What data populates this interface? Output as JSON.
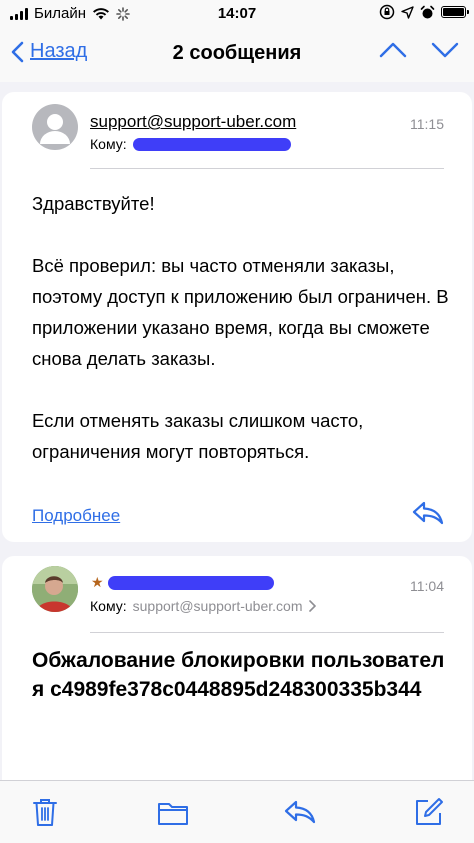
{
  "status_bar": {
    "carrier": "Билайн",
    "time": "14:07"
  },
  "nav": {
    "back_label": "Назад",
    "title": "2 сообщения"
  },
  "message1": {
    "sender": "support@support-uber.com",
    "time": "11:15",
    "to_label": "Кому:",
    "body": [
      "Здравствуйте!",
      "Всё проверил: вы часто отменяли заказы, поэтому доступ к приложению был ограничен. В приложении указано время, когда вы сможете снова делать заказы.",
      "Если отменять заказы слишком часто, ограничения могут повторяться."
    ],
    "more_label": "Подробнее"
  },
  "message2": {
    "time": "11:04",
    "to_label": "Кому:",
    "to_address": "support@support-uber.com",
    "subject": "Обжалование блокировки пользователя c4989fe378c0448895d248300335b344"
  },
  "colors": {
    "accent": "#2f6ee6",
    "redaction": "#3f3ef8",
    "secondary_text": "#8e8e93"
  },
  "icons": {
    "toolbar": [
      "trash-icon",
      "folder-icon",
      "reply-icon",
      "compose-icon"
    ]
  }
}
